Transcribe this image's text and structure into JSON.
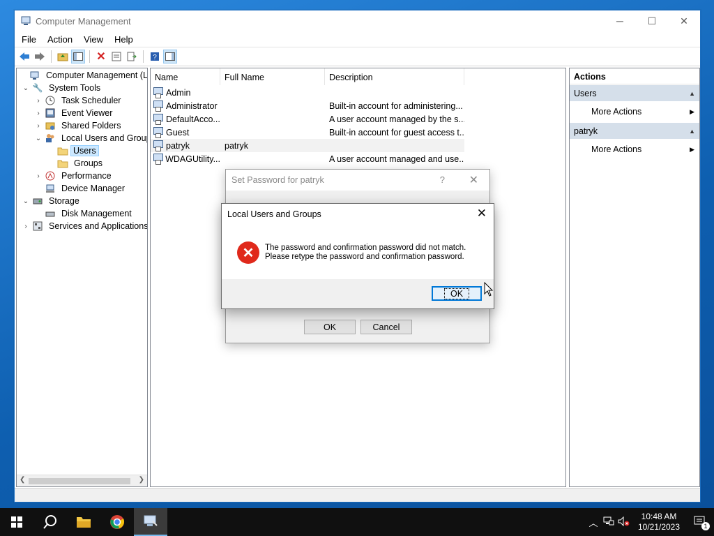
{
  "window": {
    "title": "Computer Management",
    "controls": {
      "minimize": "─",
      "maximize": "☐",
      "close": "✕"
    }
  },
  "menu": [
    "File",
    "Action",
    "View",
    "Help"
  ],
  "toolbar": {
    "icons": [
      "back-arrow-icon",
      "forward-arrow-icon",
      "up-folder-icon",
      "show-hide-tree-icon",
      "delete-icon",
      "properties-icon",
      "export-list-icon",
      "help-icon",
      "show-hide-action-pane-icon"
    ]
  },
  "tree": {
    "items": [
      {
        "label": "Computer Management (Local",
        "expander": "",
        "icon": "computer-management-icon"
      },
      {
        "label": "System Tools",
        "expander": "⌄",
        "icon": "tools-icon"
      },
      {
        "label": "Task Scheduler",
        "expander": "›",
        "icon": "clock-icon"
      },
      {
        "label": "Event Viewer",
        "expander": "›",
        "icon": "event-viewer-icon"
      },
      {
        "label": "Shared Folders",
        "expander": "›",
        "icon": "shared-folder-icon"
      },
      {
        "label": "Local Users and Groups",
        "expander": "⌄",
        "icon": "users-groups-icon"
      },
      {
        "label": "Users",
        "expander": "",
        "icon": "folder-icon"
      },
      {
        "label": "Groups",
        "expander": "",
        "icon": "folder-icon"
      },
      {
        "label": "Performance",
        "expander": "›",
        "icon": "performance-icon"
      },
      {
        "label": "Device Manager",
        "expander": "",
        "icon": "device-manager-icon"
      },
      {
        "label": "Storage",
        "expander": "⌄",
        "icon": "storage-icon"
      },
      {
        "label": "Disk Management",
        "expander": "",
        "icon": "disk-icon"
      },
      {
        "label": "Services and Applications",
        "expander": "›",
        "icon": "services-icon"
      }
    ]
  },
  "list": {
    "columns": [
      "Name",
      "Full Name",
      "Description"
    ],
    "rows": [
      {
        "name": "Admin",
        "full_name": "",
        "description": ""
      },
      {
        "name": "Administrator",
        "full_name": "",
        "description": "Built-in account for administering..."
      },
      {
        "name": "DefaultAcco...",
        "full_name": "",
        "description": "A user account managed by the s..."
      },
      {
        "name": "Guest",
        "full_name": "",
        "description": "Built-in account for guest access t..."
      },
      {
        "name": "patryk",
        "full_name": "patryk",
        "description": ""
      },
      {
        "name": "WDAGUtility...",
        "full_name": "",
        "description": "A user account managed and use..."
      }
    ]
  },
  "actions": {
    "header": "Actions",
    "groups": [
      {
        "title": "Users",
        "items": [
          "More Actions"
        ]
      },
      {
        "title": "patryk",
        "items": [
          "More Actions"
        ]
      }
    ]
  },
  "set_password_dialog": {
    "title": "Set Password for patryk",
    "help": "?",
    "close": "✕",
    "ok": "OK",
    "cancel": "Cancel"
  },
  "error_dialog": {
    "title": "Local Users and Groups",
    "close": "✕",
    "message_line1": "The password and confirmation password did not match.",
    "message_line2": "Please retype the password and confirmation password.",
    "ok": "OK",
    "icon": "error-icon"
  },
  "taskbar": {
    "apps": [
      "start-icon",
      "search-icon",
      "file-explorer-icon",
      "chrome-icon",
      "computer-management-taskbar-icon"
    ],
    "time": "10:48 AM",
    "date": "10/21/2023",
    "notification_count": "1"
  },
  "colors": {
    "accent": "#0078d7",
    "selection": "#cce8ff",
    "action_group": "#d5dfea",
    "error": "#e0291b"
  }
}
